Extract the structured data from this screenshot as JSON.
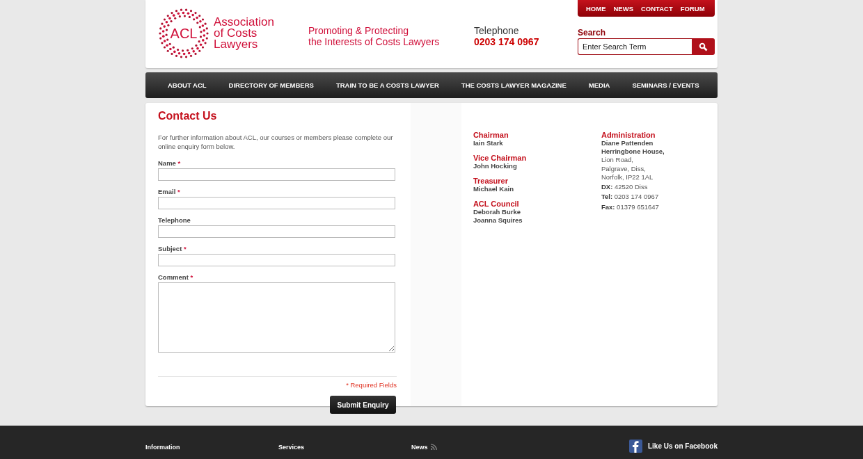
{
  "header": {
    "logo_text": "ACL",
    "logo_name": [
      "Association",
      "of Costs",
      "Lawyers"
    ],
    "tagline": [
      "Promoting & Protecting",
      "the Interests of Costs Lawyers"
    ],
    "phone_label": "Telephone",
    "phone": "0203 174 0967",
    "top_links": [
      "HOME",
      "NEWS",
      "CONTACT",
      "FORUM"
    ],
    "search": {
      "label": "Search",
      "placeholder": "Enter Search Term"
    }
  },
  "nav": [
    "ABOUT ACL",
    "DIRECTORY OF MEMBERS",
    "TRAIN TO BE A COSTS LAWYER",
    "THE COSTS LAWYER MAGAZINE",
    "MEDIA",
    "SEMINARS / EVENTS"
  ],
  "form": {
    "title": "Contact Us",
    "intro": "For further information about ACL, our courses or members please complete our online enquiry form below.",
    "fields": [
      {
        "label": "Name",
        "required": true,
        "kind": "input"
      },
      {
        "label": "Email",
        "required": true,
        "kind": "input"
      },
      {
        "label": "Telephone",
        "required": false,
        "kind": "input"
      },
      {
        "label": "Subject",
        "required": true,
        "kind": "input"
      },
      {
        "label": "Comment",
        "required": true,
        "kind": "textarea"
      }
    ],
    "required_mark": "*",
    "required_note": "* Required Fields",
    "submit": "Submit Enquiry"
  },
  "officers": [
    {
      "role": "Chairman",
      "names": [
        "Iain Stark"
      ]
    },
    {
      "role": "Vice Chairman",
      "names": [
        "John Hocking"
      ]
    },
    {
      "role": "Treasurer",
      "names": [
        "Michael Kain"
      ]
    },
    {
      "role": "ACL Council",
      "names": [
        "Deborah Burke",
        "Joanna Squires"
      ]
    }
  ],
  "administration": {
    "title": "Administration",
    "names": [
      "Diane Pattenden",
      "Herringbone House,"
    ],
    "address": [
      "Lion Road,",
      "Palgrave, Diss,",
      "Norfolk, IP22 1AL"
    ],
    "contacts": [
      "**DX:** 42520 Diss",
      "**Tel:** 0203 174 0967",
      "**Fax:** 01379 651647"
    ]
  },
  "footer": {
    "columns": [
      "Information",
      "Services",
      "News"
    ],
    "facebook": "Like Us on Facebook"
  }
}
